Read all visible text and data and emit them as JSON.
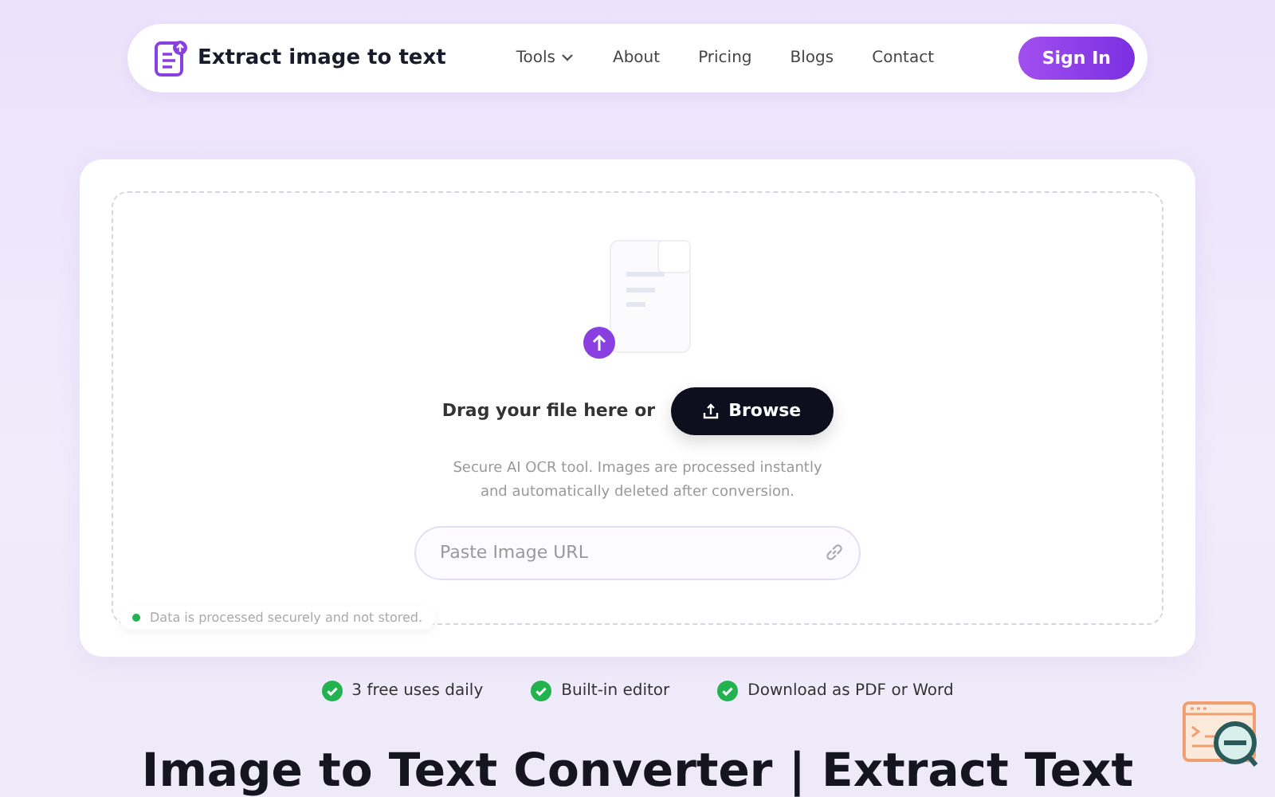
{
  "nav": {
    "brand": "Extract image to text",
    "links": [
      {
        "label": "Tools",
        "kind": "dropdown"
      },
      {
        "label": "About",
        "kind": "link"
      },
      {
        "label": "Pricing",
        "kind": "link"
      },
      {
        "label": "Blogs",
        "kind": "link"
      },
      {
        "label": "Contact",
        "kind": "link"
      }
    ],
    "sign_in": "Sign In"
  },
  "upload": {
    "drag_text": "Drag your file here or",
    "browse": "Browse",
    "note": "Secure AI OCR tool. Images are processed instantly and automatically deleted after conversion.",
    "url_field": {
      "placeholder": "Paste Image URL"
    },
    "privacy": "Data is processed securely and not stored."
  },
  "features": [
    "3 free uses daily",
    "Built-in editor",
    "Download as PDF or Word"
  ],
  "heading": "Image to Text Converter | Extract Text"
}
